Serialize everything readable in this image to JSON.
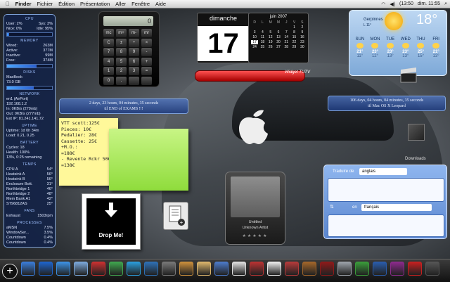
{
  "menubar": {
    "app": "Finder",
    "items": [
      "Fichier",
      "Édition",
      "Présentation",
      "Aller",
      "Fenêtre",
      "Aide"
    ],
    "battery": "(13:50",
    "clock": "dim. 11:55"
  },
  "stats": {
    "cpu_title": "CPU",
    "user": "User: 2%",
    "sys": "Sys: 3%",
    "nice": "Nice: 0%",
    "idle": "Idle: 95%",
    "memory_title": "MEMORY",
    "wired": "Wired:",
    "wired_v": "263M",
    "active": "Active:",
    "active_v": "377M",
    "inactive": "Inactive:",
    "inactive_v": "99M",
    "free": "Free:",
    "free_v": "374M",
    "disks_title": "DISKS",
    "disk_name": "MacBook",
    "disk_info": "73.0 GB",
    "network_title": "NETWORK",
    "net_name": "en1 (AirPort)",
    "net_ip": "192.168.1.2",
    "net_in": "In: 0KB/s (279mb)",
    "net_out": "Out: 0KB/s (277mb)",
    "ext_ip": "Ext IP: 81.241.141.72",
    "uptime_title": "UPTIME",
    "uptime": "Uptime: 1d 0h 34m",
    "load": "Load: 0.21, 0.25",
    "battery_title": "BATTERY",
    "cycles": "Cycles: 18",
    "health": "Health: 100%",
    "remaining": "13%, 0:25 remaining",
    "temps_title": "TEMPS",
    "temps": [
      {
        "k": "CPU A",
        "v": "54°"
      },
      {
        "k": "Heatsink A",
        "v": "56°"
      },
      {
        "k": "Heatsink B",
        "v": "56°"
      },
      {
        "k": "Enclosure Bott.",
        "v": "31°"
      },
      {
        "k": "Northbridge 1",
        "v": "46°"
      },
      {
        "k": "Northbridge 2",
        "v": "48°"
      },
      {
        "k": "Mem Bank A1",
        "v": "42°"
      },
      {
        "k": "ST96812AS",
        "v": "25°"
      }
    ],
    "fans_title": "FANS",
    "fan": "Exhaust",
    "fan_v": "1503rpm",
    "processes_title": "PROCESSES",
    "processes": [
      {
        "k": "aMSN",
        "v": "7.5%"
      },
      {
        "k": "WindowSer...",
        "v": "3.5%"
      },
      {
        "k": "Countdown",
        "v": "0.4%"
      },
      {
        "k": "Countdown",
        "v": "0.4%"
      }
    ],
    "levels": {
      "cpu": 0.05,
      "mem": 0.65,
      "disk": 0.6
    }
  },
  "calculator": {
    "display": "0",
    "keys": [
      "mc",
      "m+",
      "m-",
      "mr",
      "C",
      "±",
      "÷",
      "×",
      "7",
      "8",
      "9",
      "-",
      "4",
      "5",
      "6",
      "+",
      "1",
      "2",
      "3",
      "=",
      "0",
      ".",
      "",
      ""
    ]
  },
  "calendar": {
    "day_name": "dimanche",
    "date": "17",
    "month": "juin 2007",
    "weekdays": [
      "D",
      "L",
      "M",
      "M",
      "J",
      "V",
      "S"
    ],
    "days": [
      "",
      "",
      "",
      "",
      "",
      "1",
      "2",
      "3",
      "4",
      "5",
      "6",
      "7",
      "8",
      "9",
      "10",
      "11",
      "12",
      "13",
      "14",
      "15",
      "16",
      "17",
      "18",
      "19",
      "20",
      "21",
      "22",
      "23",
      "24",
      "25",
      "26",
      "27",
      "28",
      "29",
      "30"
    ]
  },
  "weather": {
    "city": "Gerpinnes",
    "time": "L 11°",
    "temp": "18°",
    "days": [
      {
        "d": "SUN",
        "hi": "21°",
        "lo": "11°"
      },
      {
        "d": "MON",
        "hi": "23°",
        "lo": "12°"
      },
      {
        "d": "TUE",
        "hi": "23°",
        "lo": "13°"
      },
      {
        "d": "WED",
        "hi": "23°",
        "lo": "13°"
      },
      {
        "d": "THU",
        "hi": "25°",
        "lo": "15°"
      },
      {
        "d": "FRI",
        "hi": "21°",
        "lo": "13°"
      }
    ]
  },
  "widget_red": {
    "label": "Widget TUTV"
  },
  "countdown_exams": {
    "line1": "2 days, 23 hours, 04 minutes, 35 seconds",
    "line2": "til END of EXAMS !!!"
  },
  "countdown_leopard": {
    "line1": "106 days, 04 hours, 04 minutes, 35 seconds",
    "line2": "til Mac OS X Leopard"
  },
  "note_yellow": {
    "lines": [
      "VTT scott:125€",
      "Pieces: 10€",
      "Pedalier: 28€",
      "Cassette: 25€",
      "+M.O.:",
      "=188€",
      "- Revente Rckr 50€",
      "=138€"
    ]
  },
  "dropme": {
    "label": "Drop Me!"
  },
  "itunes": {
    "title": "Untitled",
    "artist": "Unknown Artist",
    "stars": "★★★★★"
  },
  "translator": {
    "from_label": "Traduire de",
    "from_lang": "anglais",
    "to_label": "en",
    "to_lang": "français",
    "swap": "⇅"
  },
  "downloads": {
    "label": "Downloads"
  },
  "dock": {
    "add": "+",
    "icons": [
      {
        "name": "windows-icon",
        "color": "#3a7bd5"
      },
      {
        "name": "quicktime-icon",
        "color": "#1e63c9"
      },
      {
        "name": "safari-icon",
        "color": "#3c8fe0"
      },
      {
        "name": "mail-icon",
        "color": "#7aa6d8"
      },
      {
        "name": "calendar-icon",
        "color": "#c93030"
      },
      {
        "name": "msn-icon",
        "color": "#3fa34d"
      },
      {
        "name": "skype-icon",
        "color": "#2a9ad8"
      },
      {
        "name": "google-earth-icon",
        "color": "#2e6fb3"
      },
      {
        "name": "utility-icon",
        "color": "#777777"
      },
      {
        "name": "photo-icon",
        "color": "#c98d3b"
      },
      {
        "name": "preview-icon",
        "color": "#d9b36a"
      },
      {
        "name": "itunes-icon",
        "color": "#4b79c7"
      },
      {
        "name": "textedit-icon",
        "color": "#dddddd"
      },
      {
        "name": "ical-icon",
        "color": "#b73232"
      },
      {
        "name": "pages-icon",
        "color": "#e8e8e8"
      },
      {
        "name": "keynote-icon",
        "color": "#b23a3a"
      },
      {
        "name": "addressbook-icon",
        "color": "#a0652a"
      },
      {
        "name": "dictionary-icon",
        "color": "#8c1a1a"
      },
      {
        "name": "folder-icon",
        "color": "#9aa0a8"
      },
      {
        "name": "dreamweaver-icon",
        "color": "#3a9a3a"
      },
      {
        "name": "fireworks-icon",
        "color": "#2a5caa"
      },
      {
        "name": "photoshop-icon",
        "color": "#8b2a8b"
      },
      {
        "name": "acrobat-icon",
        "color": "#c42020"
      },
      {
        "name": "trash-icon",
        "color": "#555555"
      }
    ]
  }
}
